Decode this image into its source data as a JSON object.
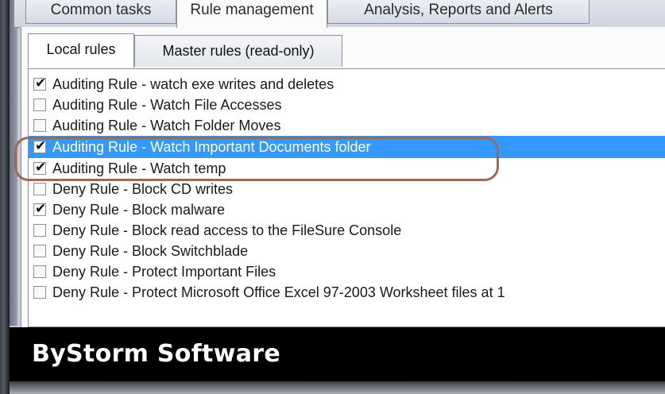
{
  "tabs": {
    "outer": [
      {
        "label": "Common tasks",
        "active": false
      },
      {
        "label": "Rule management",
        "active": true
      },
      {
        "label": "Analysis, Reports and Alerts",
        "active": false
      }
    ],
    "inner": [
      {
        "label": "Local rules",
        "active": true
      },
      {
        "label": "Master rules (read-only)",
        "active": false
      }
    ]
  },
  "rules": [
    {
      "label": "Auditing Rule - watch exe writes and deletes",
      "checked": true,
      "selected": false
    },
    {
      "label": "Auditing Rule - Watch File Accesses",
      "checked": false,
      "selected": false
    },
    {
      "label": "Auditing Rule - Watch Folder Moves",
      "checked": false,
      "selected": false
    },
    {
      "label": "Auditing Rule - Watch Important Documents folder",
      "checked": true,
      "selected": true
    },
    {
      "label": "Auditing Rule - Watch temp",
      "checked": true,
      "selected": false
    },
    {
      "label": "Deny Rule - Block CD writes",
      "checked": false,
      "selected": false
    },
    {
      "label": "Deny Rule - Block malware",
      "checked": true,
      "selected": false
    },
    {
      "label": "Deny Rule - Block read access to the FileSure Console",
      "checked": false,
      "selected": false
    },
    {
      "label": "Deny Rule - Block Switchblade",
      "checked": false,
      "selected": false
    },
    {
      "label": "Deny Rule - Protect Important Files",
      "checked": false,
      "selected": false
    },
    {
      "label": "Deny Rule - Protect Microsoft Office Excel 97-2003 Worksheet files at 1",
      "checked": false,
      "selected": false
    }
  ],
  "brand": {
    "text": "ByStorm Software"
  },
  "colors": {
    "selection": "#3399ff",
    "annotation": "#9c6a52",
    "brand_background": "#000000"
  }
}
